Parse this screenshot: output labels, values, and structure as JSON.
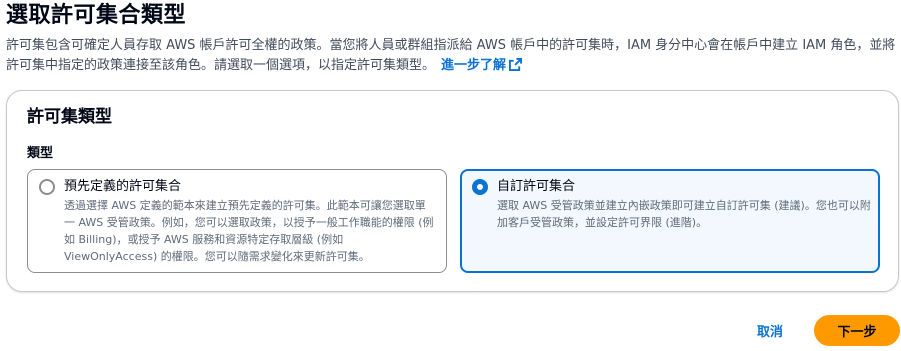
{
  "page": {
    "title": "選取許可集合類型",
    "description": "許可集包含可確定人員存取 AWS 帳戶許可全權的政策。當您將人員或群組指派給 AWS 帳戶中的許可集時，IAM 身分中心會在帳戶中建立 IAM 角色，並將許可集中指定的政策連接至該角色。請選取一個選項，以指定許可集類型。",
    "learn_more": "進一步了解",
    "learn_more_icon": "external-link-icon"
  },
  "container": {
    "title": "許可集類型",
    "field_label": "類型",
    "options": [
      {
        "title": "預先定義的許可集合",
        "description": "透過選擇 AWS 定義的範本來建立預先定義的許可集。此範本可讓您選取單一 AWS 受管政策。例如，您可以選取政策，以授予一般工作職能的權限 (例如 Billing)，或授予 AWS 服務和資源特定存取層級 (例如 ViewOnlyAccess) 的權限。您可以隨需求變化來更新許可集。",
        "selected": false
      },
      {
        "title": "自訂許可集合",
        "description": "選取 AWS 受管政策並建立內嵌政策即可建立自訂許可集 (建議)。您也可以附加客戶受管政策，並設定許可界限 (進階)。",
        "selected": true
      }
    ]
  },
  "actions": {
    "cancel": "取消",
    "next": "下一步"
  },
  "colors": {
    "accent": "#0972d3",
    "primary_button": "#ff9900",
    "selected_tile_bg": "#f2f8fd"
  }
}
